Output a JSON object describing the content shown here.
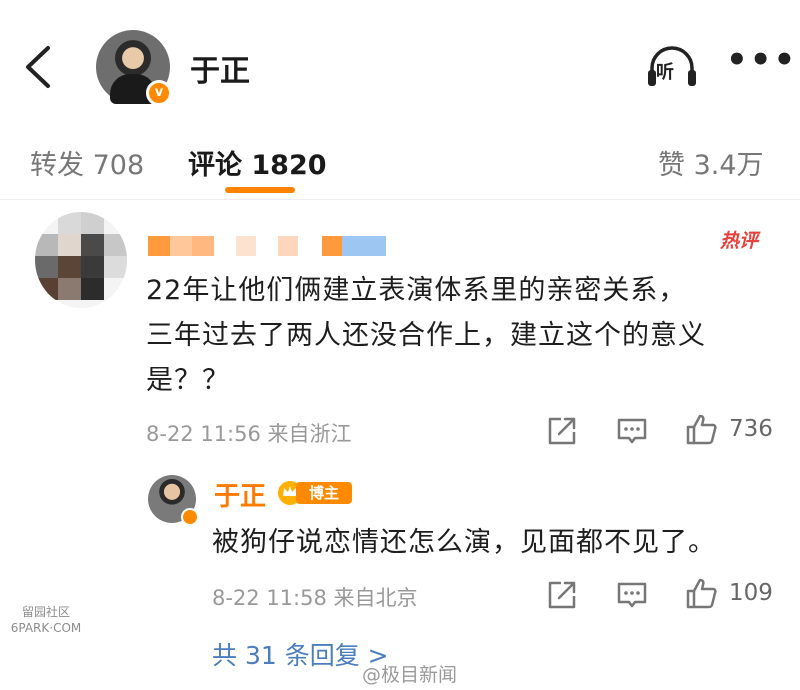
{
  "header": {
    "user_name": "于正",
    "listen_label": "听",
    "more_label": "•••"
  },
  "tabs": {
    "repost": "转发 708",
    "comments": "评论 1820",
    "likes": "赞 3.4万"
  },
  "comment": {
    "hot_badge": "热评",
    "text_lines": [
      "22年让他们俩建立表演体系里的亲密关系，",
      "三年过去了两人还没合作上，建立这个的意义",
      "是？？"
    ],
    "meta": "8-22 11:56 来自浙江",
    "like_count": "736"
  },
  "reply": {
    "author": "于正",
    "badge_label": "博主",
    "text": "被狗仔说恋情还怎么演，见面都不见了。",
    "meta": "8-22 11:58 来自北京",
    "like_count": "109"
  },
  "more_replies": "共 31 条回复 >",
  "watermarks": {
    "left_line1": "留园社区",
    "left_line2": "6PARK·COM",
    "right": "@极目新闻"
  },
  "colors": {
    "accent": "#ff8200",
    "link": "#4a7ebf",
    "hot": "#e8403a"
  }
}
